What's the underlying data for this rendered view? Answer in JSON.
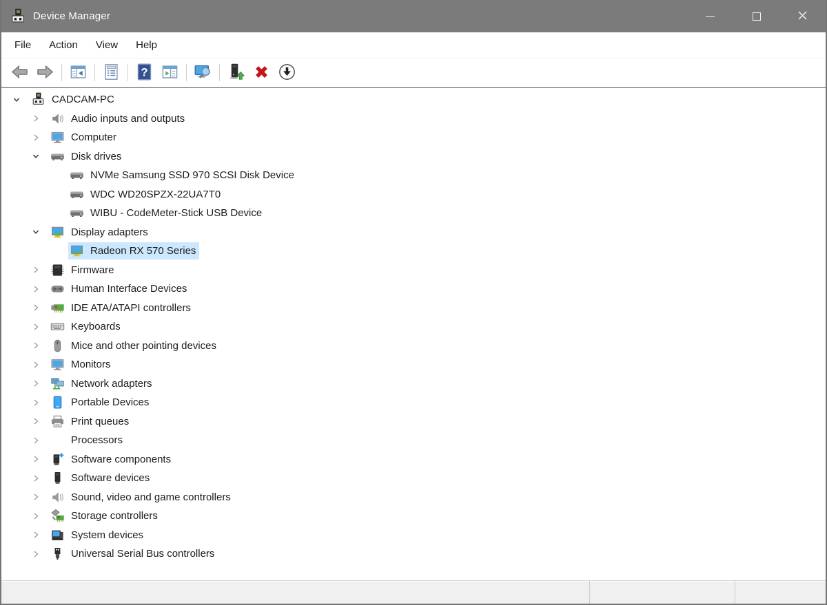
{
  "window": {
    "title": "Device Manager",
    "app_icon": "device-manager-icon",
    "controls": [
      {
        "name": "minimize-button",
        "icon": "minimize-icon"
      },
      {
        "name": "maximize-button",
        "icon": "maximize-icon"
      },
      {
        "name": "close-button",
        "icon": "close-icon"
      }
    ]
  },
  "colors": {
    "titlebar": "#7b7b7b",
    "selection": "#cce8ff",
    "uninstall_red": "#c4161c",
    "help_blue": "#33518e",
    "monitor_blue": "#4da6e8",
    "arrow_green": "#4caf50"
  },
  "menu": {
    "items": [
      {
        "label": "File"
      },
      {
        "label": "Action"
      },
      {
        "label": "View"
      },
      {
        "label": "Help"
      }
    ]
  },
  "toolbar": {
    "items": [
      {
        "name": "back-button",
        "icon": "back-icon"
      },
      {
        "name": "forward-button",
        "icon": "forward-icon"
      },
      {
        "type": "separator"
      },
      {
        "name": "show-console-tree-button",
        "icon": "console-tree-icon"
      },
      {
        "type": "separator"
      },
      {
        "name": "properties-button",
        "icon": "properties-icon"
      },
      {
        "type": "separator"
      },
      {
        "name": "help-button",
        "icon": "help-icon"
      },
      {
        "name": "show-action-pane-button",
        "icon": "action-pane-icon"
      },
      {
        "type": "separator"
      },
      {
        "name": "scan-hardware-changes-button",
        "icon": "scan-hardware-icon"
      },
      {
        "type": "separator"
      },
      {
        "name": "update-driver-button",
        "icon": "update-driver-icon"
      },
      {
        "name": "uninstall-device-button",
        "icon": "uninstall-icon"
      },
      {
        "name": "disable-device-button",
        "icon": "disable-icon"
      }
    ]
  },
  "tree": {
    "items": [
      {
        "label": "CADCAM-PC",
        "level": 0,
        "state": "expanded",
        "icon": "computer-node-icon",
        "selected": false
      },
      {
        "label": "Audio inputs and outputs",
        "level": 1,
        "state": "collapsed",
        "icon": "audio-icon",
        "selected": false
      },
      {
        "label": "Computer",
        "level": 1,
        "state": "collapsed",
        "icon": "computer-icon",
        "selected": false
      },
      {
        "label": "Disk drives",
        "level": 1,
        "state": "expanded",
        "icon": "disk-drive-icon",
        "selected": false
      },
      {
        "label": "NVMe Samsung SSD 970 SCSI Disk Device",
        "level": 2,
        "state": "leaf",
        "icon": "disk-drive-icon",
        "selected": false
      },
      {
        "label": "WDC WD20SPZX-22UA7T0",
        "level": 2,
        "state": "leaf",
        "icon": "disk-drive-icon",
        "selected": false
      },
      {
        "label": "WIBU - CodeMeter-Stick USB Device",
        "level": 2,
        "state": "leaf",
        "icon": "disk-drive-icon",
        "selected": false
      },
      {
        "label": "Display adapters",
        "level": 1,
        "state": "expanded",
        "icon": "display-adapter-icon",
        "selected": false
      },
      {
        "label": "Radeon RX 570 Series",
        "level": 2,
        "state": "leaf",
        "icon": "display-adapter-icon",
        "selected": true
      },
      {
        "label": "Firmware",
        "level": 1,
        "state": "collapsed",
        "icon": "firmware-icon",
        "selected": false
      },
      {
        "label": "Human Interface Devices",
        "level": 1,
        "state": "collapsed",
        "icon": "hid-icon",
        "selected": false
      },
      {
        "label": "IDE ATA/ATAPI controllers",
        "level": 1,
        "state": "collapsed",
        "icon": "ide-controller-icon",
        "selected": false
      },
      {
        "label": "Keyboards",
        "level": 1,
        "state": "collapsed",
        "icon": "keyboard-icon",
        "selected": false
      },
      {
        "label": "Mice and other pointing devices",
        "level": 1,
        "state": "collapsed",
        "icon": "mouse-icon",
        "selected": false
      },
      {
        "label": "Monitors",
        "level": 1,
        "state": "collapsed",
        "icon": "monitor-icon",
        "selected": false
      },
      {
        "label": "Network adapters",
        "level": 1,
        "state": "collapsed",
        "icon": "network-adapter-icon",
        "selected": false
      },
      {
        "label": "Portable Devices",
        "level": 1,
        "state": "collapsed",
        "icon": "portable-device-icon",
        "selected": false
      },
      {
        "label": "Print queues",
        "level": 1,
        "state": "collapsed",
        "icon": "print-queue-icon",
        "selected": false
      },
      {
        "label": "Processors",
        "level": 1,
        "state": "collapsed",
        "icon": "processor-icon",
        "selected": false
      },
      {
        "label": "Software components",
        "level": 1,
        "state": "collapsed",
        "icon": "software-component-icon",
        "selected": false
      },
      {
        "label": "Software devices",
        "level": 1,
        "state": "collapsed",
        "icon": "software-device-icon",
        "selected": false
      },
      {
        "label": "Sound, video and game controllers",
        "level": 1,
        "state": "collapsed",
        "icon": "sound-controller-icon",
        "selected": false
      },
      {
        "label": "Storage controllers",
        "level": 1,
        "state": "collapsed",
        "icon": "storage-controller-icon",
        "selected": false
      },
      {
        "label": "System devices",
        "level": 1,
        "state": "collapsed",
        "icon": "system-device-icon",
        "selected": false
      },
      {
        "label": "Universal Serial Bus controllers",
        "level": 1,
        "state": "collapsed",
        "icon": "usb-controller-icon",
        "selected": false
      }
    ]
  },
  "status_bar": {
    "sections": [
      "",
      "",
      ""
    ]
  }
}
